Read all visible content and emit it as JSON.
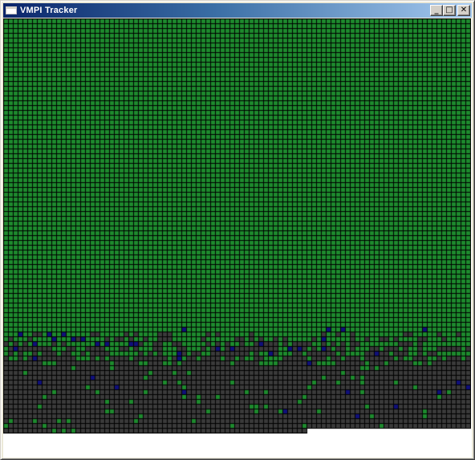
{
  "window": {
    "title": "VMPI Tracker",
    "icon": "app-window-icon",
    "controls": [
      {
        "name": "minimize-button",
        "icon": "minimize-icon",
        "glyph": "_"
      },
      {
        "name": "maximize-button",
        "icon": "maximize-icon",
        "glyph": "□"
      },
      {
        "name": "close-button",
        "icon": "close-icon",
        "glyph": "✕"
      }
    ]
  },
  "tracker": {
    "columns": 97,
    "rows": 86,
    "last_row_cells": 63,
    "status_colors": {
      "done": "#1e8a2e",
      "idle": "#3a3a3a",
      "busy": "#10107a",
      "grid_line": "#000000"
    }
  }
}
